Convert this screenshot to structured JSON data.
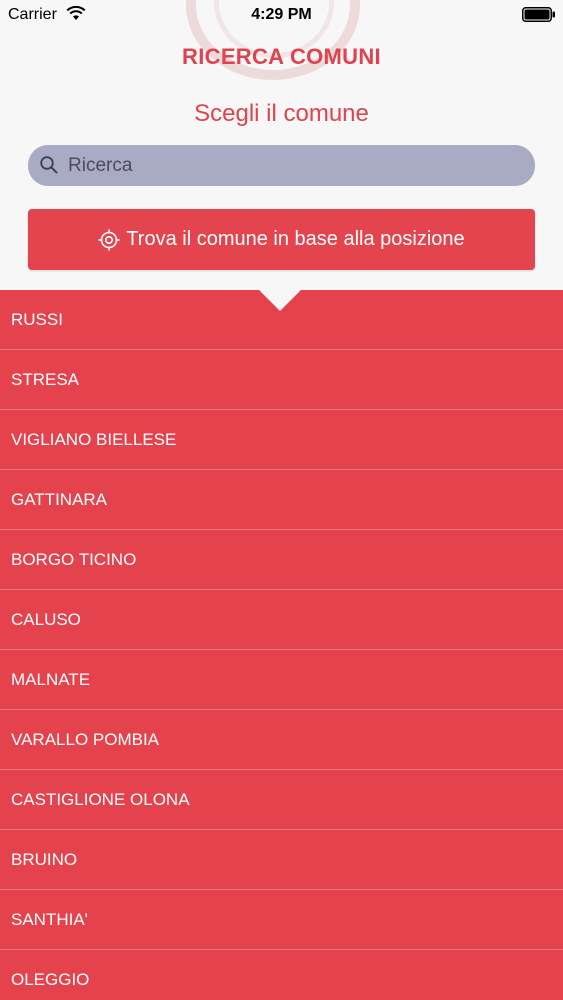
{
  "status_bar": {
    "carrier": "Carrier",
    "time": "4:29 PM"
  },
  "header": {
    "title": "RICERCA COMUNI",
    "subtitle": "Scegli il comune"
  },
  "search": {
    "placeholder": "Ricerca",
    "value": ""
  },
  "locate_button": {
    "label": "Trova il comune in base alla posizione",
    "icon": "target-icon"
  },
  "colors": {
    "accent": "#e3444e",
    "search_background": "#a9aac3",
    "page_background": "#f7f7f7"
  },
  "comuni": [
    "RUSSI",
    "STRESA",
    "VIGLIANO BIELLESE",
    "GATTINARA",
    "BORGO TICINO",
    "CALUSO",
    "MALNATE",
    "VARALLO POMBIA",
    "CASTIGLIONE OLONA",
    "BRUINO",
    "SANTHIA'",
    "OLEGGIO"
  ]
}
